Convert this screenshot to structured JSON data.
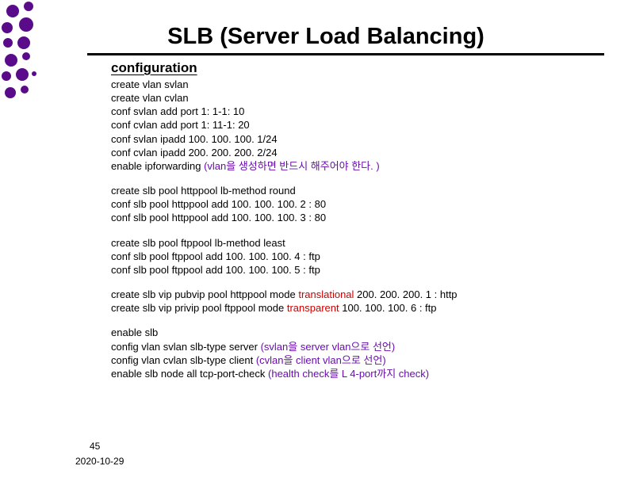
{
  "title": "SLB (Server Load Balancing)",
  "subtitle": "configuration",
  "block1": {
    "l1": "create vlan svlan",
    "l2": "create vlan cvlan",
    "l3": "conf svlan add port 1: 1-1: 10",
    "l4": "conf cvlan add port 1: 11-1: 20",
    "l5": "conf svlan ipadd 100. 100. 100. 1/24",
    "l6": "conf cvlan ipadd 200. 200. 200. 2/24",
    "l7a": "enable ipforwarding  ",
    "l7b": "(vlan을 생성하면 반드시 해주어야 한다. )"
  },
  "block2": {
    "l1": "create slb pool httppool lb-method round",
    "l2": "conf slb pool httppool add 100. 100. 100. 2 : 80",
    "l3": "conf slb pool httppool add 100. 100. 100. 3 : 80"
  },
  "block3": {
    "l1": "create slb pool ftppool lb-method least",
    "l2": "conf slb pool ftppool add 100. 100. 100. 4 : ftp",
    "l3": "conf slb pool ftppool add 100. 100. 100. 5 : ftp"
  },
  "block4": {
    "l1a": "create slb vip pubvip pool httppool mode ",
    "l1b": "translational",
    "l1c": " 200. 200. 200. 1 : http",
    "l2a": "create slb vip privip pool ftppool mode ",
    "l2b": "transparent",
    "l2c": " 100. 100. 100. 6 : ftp"
  },
  "block5": {
    "l1": "enable slb",
    "l2a": "config vlan svlan slb-type server      ",
    "l2b": "(svlan을 server vlan으로 선언)",
    "l3a": "config vlan cvlan slb-type client        ",
    "l3b": "(cvlan을 client vlan으로 선언)",
    "l4a": "enable slb node all tcp-port-check    ",
    "l4b": "(health check를 L 4-port까지 check)"
  },
  "footer": {
    "page": "45",
    "date": "2020-10-29"
  }
}
